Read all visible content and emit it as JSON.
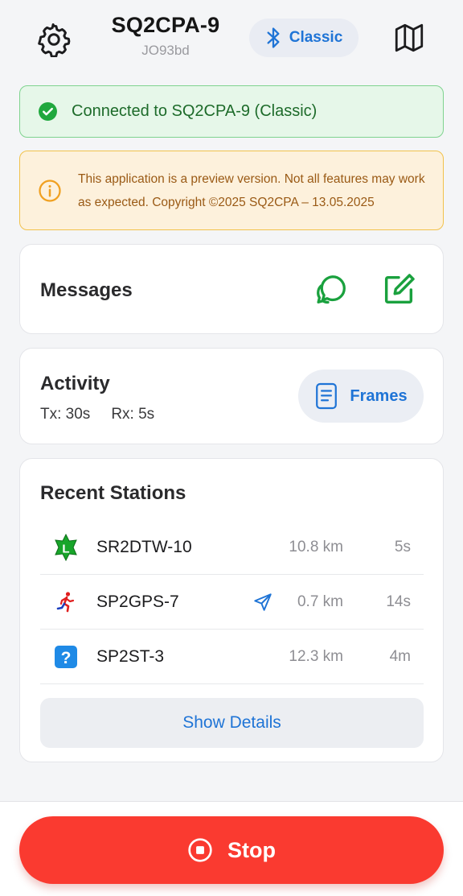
{
  "header": {
    "callsign": "SQ2CPA-9",
    "locator": "JO93bd",
    "mode_label": "Classic",
    "settings_icon": "gear-icon",
    "map_icon": "map-icon",
    "mode_icon": "bluetooth-icon"
  },
  "status_banner": {
    "text": "Connected to SQ2CPA-9 (Classic)",
    "icon": "check-circle-icon",
    "color": "#1d6b2a"
  },
  "warning_banner": {
    "text": "This application is a preview version. Not all features may work as expected. Copyright ©2025 SQ2CPA – 13.05.2025",
    "icon": "info-circle-icon",
    "color": "#f0a020"
  },
  "messages": {
    "title": "Messages",
    "chat_icon": "chat-icon",
    "compose_icon": "compose-icon"
  },
  "activity": {
    "title": "Activity",
    "tx": "Tx: 30s",
    "rx": "Rx: 5s",
    "frames_label": "Frames",
    "frames_icon": "document-icon"
  },
  "stations": {
    "title": "Recent Stations",
    "rows": [
      {
        "name": "SR2DTW-10",
        "distance": "10.8 km",
        "age": "5s",
        "icon": "star-l-icon",
        "navigating": false
      },
      {
        "name": "SP2GPS-7",
        "distance": "0.7 km",
        "age": "14s",
        "icon": "runner-icon",
        "navigating": true
      },
      {
        "name": "SP2ST-3",
        "distance": "12.3 km",
        "age": "4m",
        "icon": "question-icon",
        "navigating": false
      }
    ],
    "details_label": "Show Details"
  },
  "footer": {
    "stop_label": "Stop",
    "stop_icon": "stop-circle-icon",
    "stop_color": "#fa3a30"
  }
}
